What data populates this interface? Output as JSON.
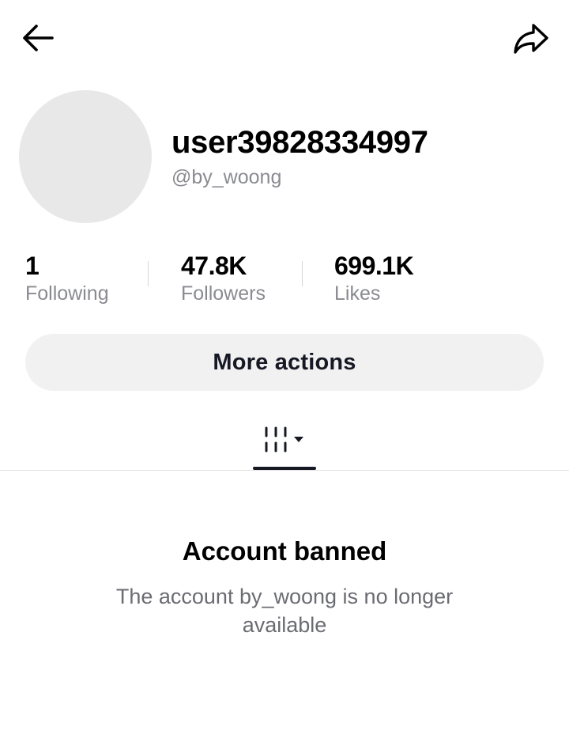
{
  "header": {
    "back_icon": "arrow-left-icon",
    "share_icon": "share-arrow-icon"
  },
  "profile": {
    "username": "user39828334997",
    "handle": "@by_woong",
    "avatar_color": "#e8e8e8"
  },
  "stats": [
    {
      "value": "1",
      "label": "Following"
    },
    {
      "value": "47.8K",
      "label": "Followers"
    },
    {
      "value": "699.1K",
      "label": "Likes"
    }
  ],
  "actions": {
    "more_actions_label": "More actions"
  },
  "tabs": {
    "videos_icon": "video-grid-icon",
    "dropdown_icon": "caret-down-icon"
  },
  "empty_state": {
    "title": "Account banned",
    "message": "The account by_woong is no longer available"
  },
  "colors": {
    "text_primary": "#161823",
    "text_secondary": "#8a8b91",
    "button_bg": "#f1f1f2"
  }
}
